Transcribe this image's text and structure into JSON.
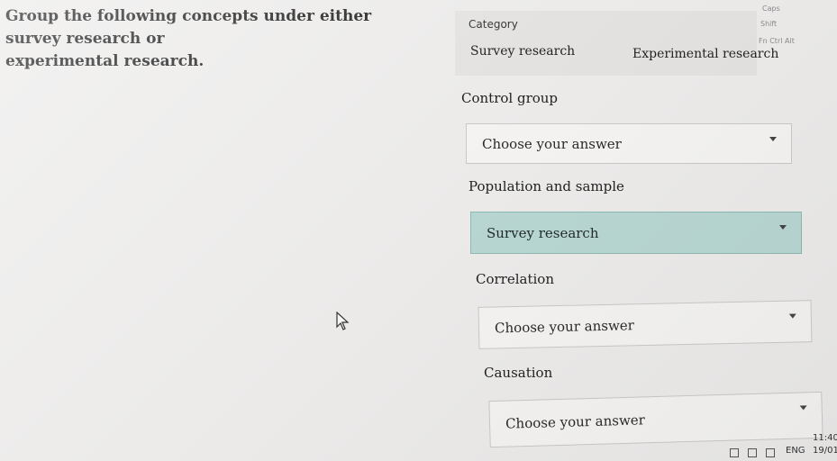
{
  "question": {
    "line1": "Group the following concepts under either survey research or",
    "line2": "experimental research."
  },
  "category": {
    "title": "Category",
    "options": [
      "Survey research",
      "Experimental research"
    ]
  },
  "concepts": [
    {
      "label": "Control group",
      "answer": "Choose your answer"
    },
    {
      "label": "Population and sample",
      "answer": "Survey research"
    },
    {
      "label": "Correlation",
      "answer": "Choose your answer"
    },
    {
      "label": "Causation",
      "answer": "Choose your answer"
    }
  ],
  "keyboard": {
    "caps": "Caps",
    "shift": "Shift",
    "fn": "Fn  Ctrl  Alt"
  },
  "taskbar": {
    "language": "ENG",
    "time": "11:40",
    "date": "19/01/"
  },
  "colors": {
    "selected_answer_bg": "#b8d6d2",
    "panel_bg": "#e3e2e0"
  }
}
